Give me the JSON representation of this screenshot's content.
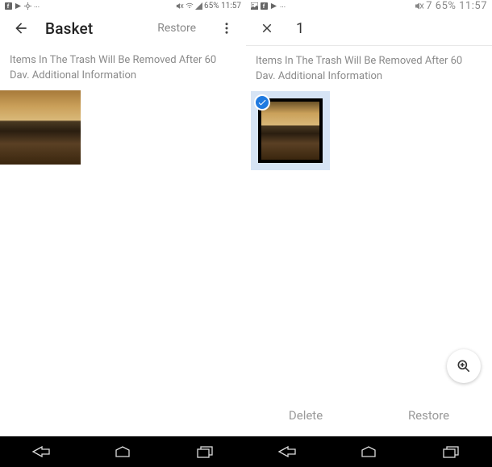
{
  "left": {
    "statusbar": {
      "right_text": "65% 11:57"
    },
    "appbar": {
      "title": "Basket",
      "restore_label": "Restore"
    },
    "message": {
      "line1": "Items In The Trash Will Be Removed After 60",
      "line2": "Dav. Additional Information"
    }
  },
  "right": {
    "statusbar": {
      "right_text": "7 65% 11:57"
    },
    "appbar": {
      "count": "1"
    },
    "message": {
      "line1": "Items In The Trash Will Be Removed After 60",
      "line2": "Dav. Additional Information"
    },
    "actions": {
      "delete": "Delete",
      "restore": "Restore"
    }
  }
}
